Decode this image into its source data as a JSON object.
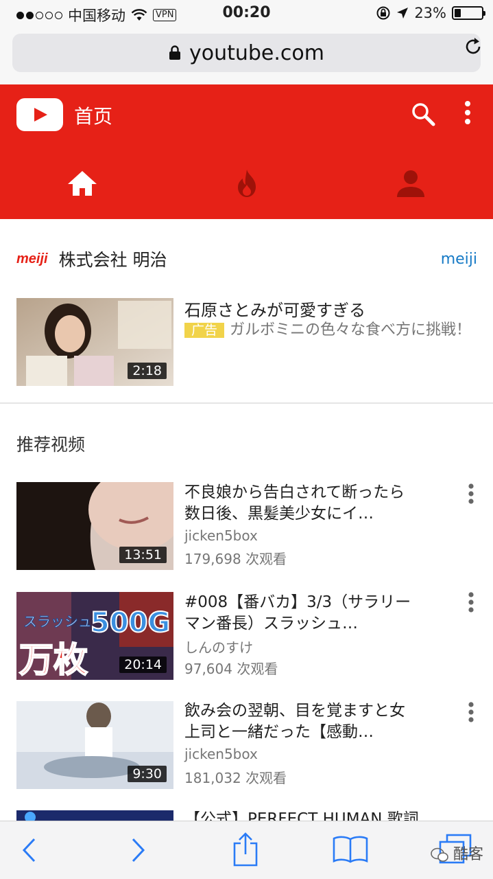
{
  "status_bar": {
    "carrier": "中国移动",
    "vpn": "VPN",
    "time": "00:20",
    "battery": "23%",
    "battery_level": 0.23
  },
  "browser": {
    "url": "youtube.com"
  },
  "header": {
    "title": "首页",
    "brand_color": "#e62117",
    "tabs": [
      "home-icon",
      "trending-icon",
      "account-icon"
    ]
  },
  "ad": {
    "brand_logo": "meiji",
    "brand_name": "株式会社 明治",
    "brand_link": "meiji",
    "title": "石原さとみが可愛すぎる",
    "badge": "广告",
    "description": "ガルボミニの色々な食べ方に挑戦！",
    "duration": "2:18"
  },
  "section_title": "推荐视频",
  "videos": [
    {
      "title": "不良娘から告白されて断ったら数日後、黒髪美少女にイ…",
      "channel": "jicken5box",
      "views": "179,698 次观看",
      "duration": "13:51"
    },
    {
      "title": "#008【番バカ】3/3（サラリーマン番長）スラッシュ…",
      "channel": "しんのすけ",
      "views": "97,604 次观看",
      "duration": "20:14",
      "thumb_text": [
        "スラッシュ",
        "500G",
        "万枚"
      ]
    },
    {
      "title": "飲み会の翌朝、目を覚ますと女上司と一緒だった【感動…",
      "channel": "jicken5box",
      "views": "181,032 次观看",
      "duration": "9:30"
    },
    {
      "title": "【公式】PERFECT HUMAN 歌詞"
    }
  ],
  "watermark": "酷客"
}
